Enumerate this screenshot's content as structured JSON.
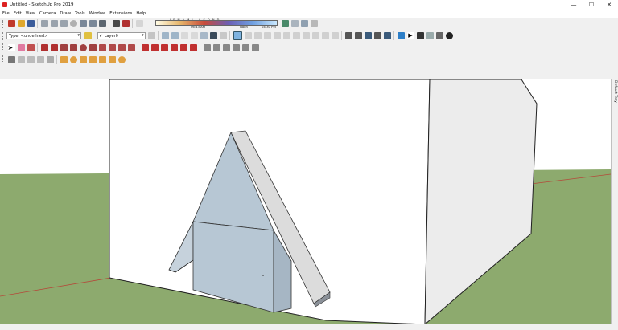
{
  "window": {
    "title": "Untitled - SketchUp Pro 2019",
    "controls": [
      "—",
      "☐",
      "✕"
    ]
  },
  "menu": [
    "File",
    "Edit",
    "View",
    "Camera",
    "Draw",
    "Tools",
    "Window",
    "Extensions",
    "Help"
  ],
  "shadows": {
    "months": "JFMAMJJASOND",
    "time_left": "06:43 AM",
    "time_mid": "Noon",
    "time_right": "04:30 PM"
  },
  "entity_info": {
    "type_label": "Type: <undefined>"
  },
  "layer": {
    "value": "Layer0"
  },
  "tray": {
    "label": "Default Tray"
  },
  "colors": {
    "sky": "#ffffff",
    "ground": "#8daa6e",
    "wall_front": "#ffffff",
    "wall_side": "#ececec",
    "house_front": "#b7c7d4",
    "roof_light": "#dcdcdc",
    "axis_red": "#b44a3a"
  }
}
